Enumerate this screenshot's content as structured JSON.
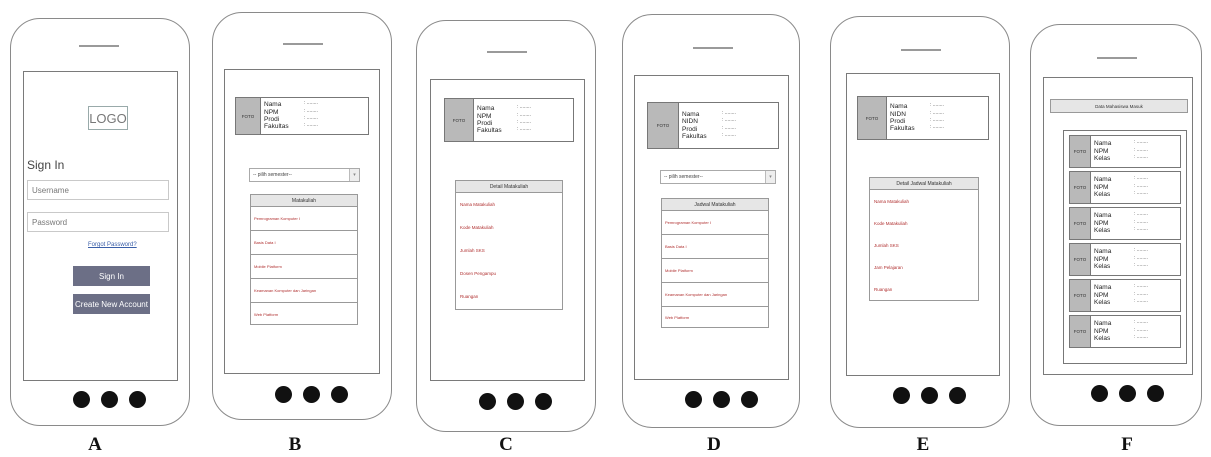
{
  "labels": [
    "A",
    "B",
    "C",
    "D",
    "E",
    "F"
  ],
  "screen_a": {
    "logo": "LOGO",
    "title": "Sign In",
    "username_placeholder": "Username",
    "password_placeholder": "Password",
    "forgot": "Forgot Password?",
    "signin_button": "Sign In",
    "create_button": "Create New Account"
  },
  "foto": "FOTO",
  "value_dash": ": ........",
  "select_placeholder": "-- pilih semester--",
  "screen_b": {
    "profile_labels": [
      "Nama",
      "NPM",
      "Prodi",
      "Fakultas"
    ],
    "list_title": "Matakuliah",
    "items": [
      "Pemrograman Komputer I",
      "Basis Data I",
      "Mobile Platform",
      "Keamanan Komputer dan Jaringan",
      "Web Platform"
    ]
  },
  "screen_c": {
    "profile_labels": [
      "Nama",
      "NPM",
      "Prodi",
      "Fakultas"
    ],
    "detail_title": "Detail Matakuliah",
    "details": [
      "Nama Matakuliah",
      "Kode Matakuliah",
      "Jumlah SKS",
      "Dosen Pengampu",
      "Ruangan"
    ]
  },
  "screen_d": {
    "profile_labels": [
      "Nama",
      "NIDN",
      "Prodi",
      "Fakultas"
    ],
    "list_title": "Jadwal Matakuliah",
    "items": [
      "Pemrograman Komputer I",
      "Basis Data I",
      "Mobile Platform",
      "Keamanan Komputer dan Jaringan",
      "Web Platform"
    ]
  },
  "screen_e": {
    "profile_labels": [
      "Nama",
      "NIDN",
      "Prodi",
      "Fakultas"
    ],
    "detail_title": "Detail Jadwal Matakuliah",
    "details": [
      "Nama Matakuliah",
      "Kode Matakuliah",
      "Jumlah SKS",
      "Jam Pelajaran",
      "Ruangan"
    ]
  },
  "screen_f": {
    "title": "Data Mahasiswa Masuk",
    "card_labels": [
      "Nama",
      "NPM",
      "Kelas"
    ],
    "card_count": 6
  }
}
